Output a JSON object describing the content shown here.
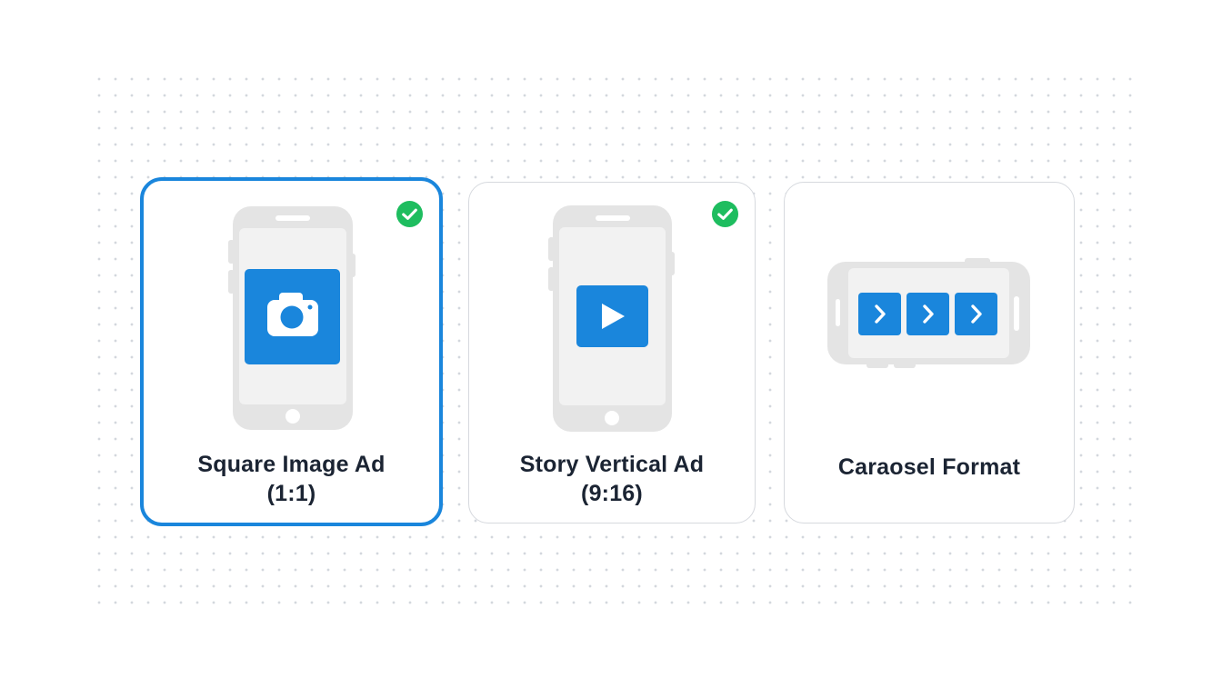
{
  "colors": {
    "accent": "#1a86dc",
    "check": "#1ebd5f",
    "device": "#e4e4e4",
    "text": "#1b2433",
    "card_border": "#d6d9de"
  },
  "cards": [
    {
      "id": "square",
      "line1": "Square Image Ad",
      "line2": "(1:1)",
      "icon": "camera-icon",
      "selected": true,
      "checked": true
    },
    {
      "id": "story",
      "line1": "Story Vertical Ad",
      "line2": "(9:16)",
      "icon": "play-icon",
      "selected": false,
      "checked": true
    },
    {
      "id": "carousel",
      "line1": "Caraosel Format",
      "icon": "chevron-right-icon",
      "selected": false,
      "checked": false
    }
  ]
}
